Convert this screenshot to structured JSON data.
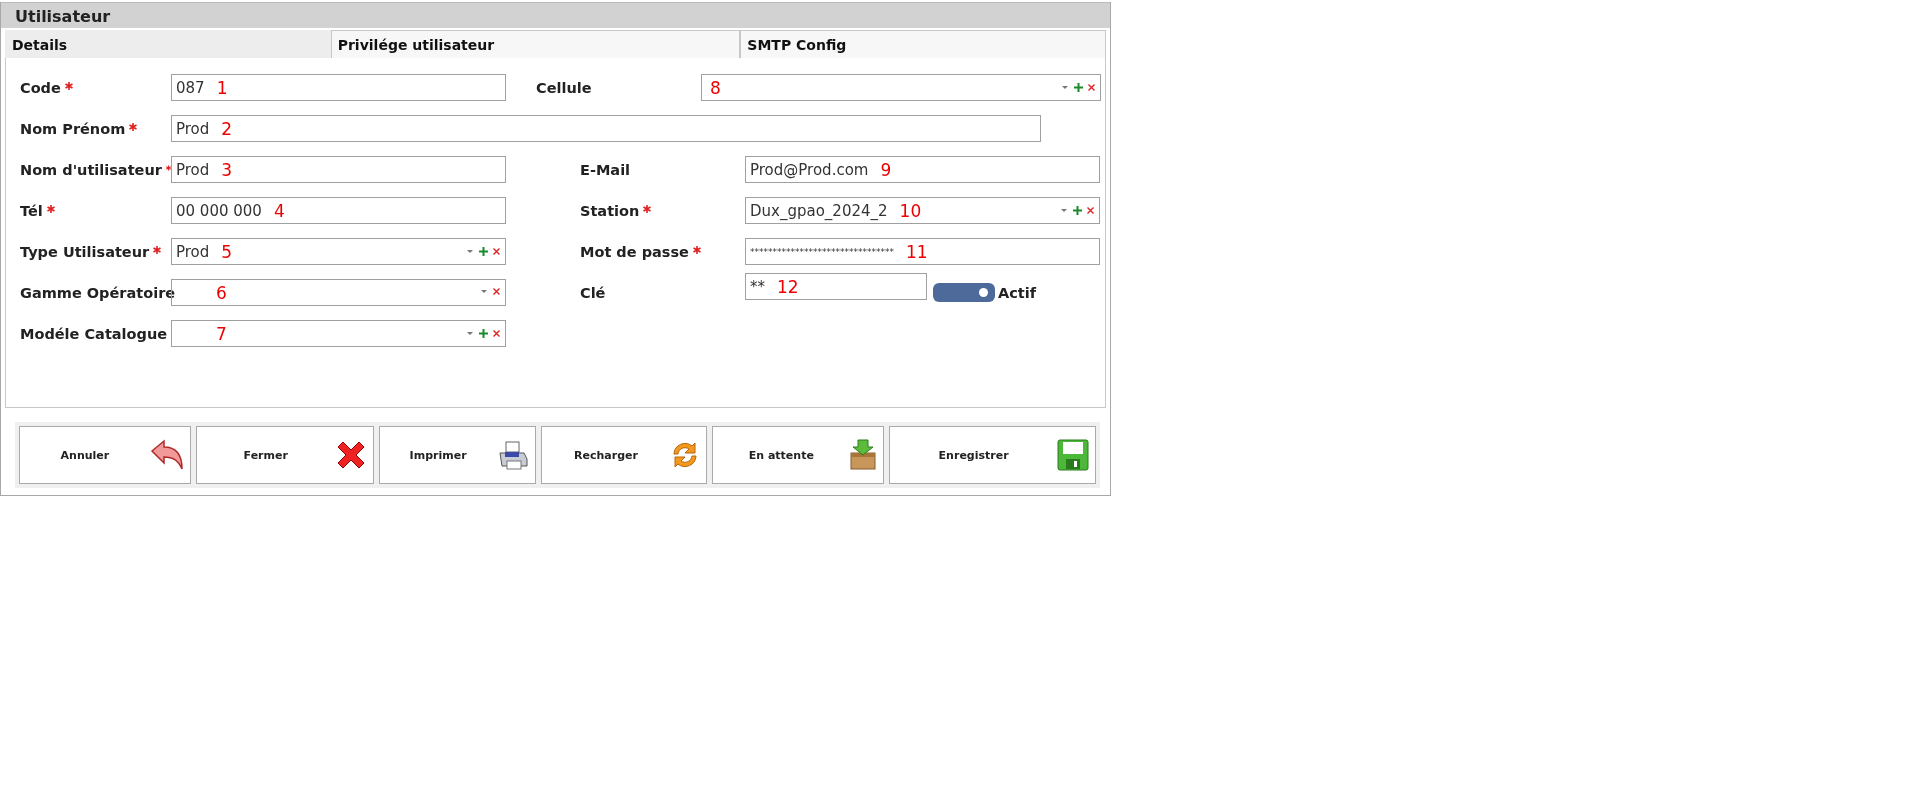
{
  "window": {
    "title": "Utilisateur"
  },
  "tabs": [
    {
      "label": "Details",
      "selected": true
    },
    {
      "label": "Privilége utilisateur",
      "selected": false
    },
    {
      "label": "SMTP Config",
      "selected": false
    }
  ],
  "rows": [
    [
      {
        "label": "Code",
        "required": true,
        "kind": "text",
        "value": "087",
        "marker": "1"
      },
      {
        "label": "Cellule",
        "required": false,
        "kind": "combo",
        "has_add": true,
        "marker": "8"
      }
    ],
    [
      {
        "label": "Nom Prénom",
        "required": true,
        "kind": "text",
        "value": "Prod",
        "marker": "2"
      }
    ],
    [
      {
        "label": "Nom d'utilisateur",
        "required": true,
        "kind": "text",
        "value": "Prod",
        "marker": "3"
      },
      {
        "label": "E-Mail",
        "required": false,
        "kind": "text",
        "value": "Prod@Prod.com",
        "marker": "9"
      }
    ],
    [
      {
        "label": "Tél",
        "required": true,
        "kind": "text",
        "value": "00 000 000",
        "marker": "4"
      },
      {
        "label": "Station",
        "required": true,
        "kind": "combo",
        "has_add": true,
        "value": "Dux_gpao_2024_2",
        "marker": "10"
      }
    ],
    [
      {
        "label": "Type Utilisateur",
        "required": true,
        "kind": "combo",
        "has_add": true,
        "value": "Prod",
        "marker": "5"
      },
      {
        "label": "Mot de passe",
        "required": true,
        "kind": "password",
        "value": "********************************",
        "marker": "11"
      }
    ],
    [
      {
        "label": "Gamme Opératoire",
        "required": false,
        "kind": "combo",
        "has_add": false,
        "marker": "6"
      },
      {
        "label": "Clé",
        "required": false,
        "kind": "key",
        "value": "**",
        "marker": "12",
        "toggle": {
          "label": "Actif",
          "on": true
        }
      }
    ],
    [
      {
        "label": "Modéle Catalogue",
        "required": false,
        "kind": "combo",
        "has_add": true,
        "marker": "7"
      }
    ]
  ],
  "buttons": [
    {
      "label": "Annuler"
    },
    {
      "label": "Fermer"
    },
    {
      "label": "Imprimer"
    },
    {
      "label": "Recharger"
    },
    {
      "label": "En attente"
    },
    {
      "label": "Enregistrer"
    }
  ]
}
